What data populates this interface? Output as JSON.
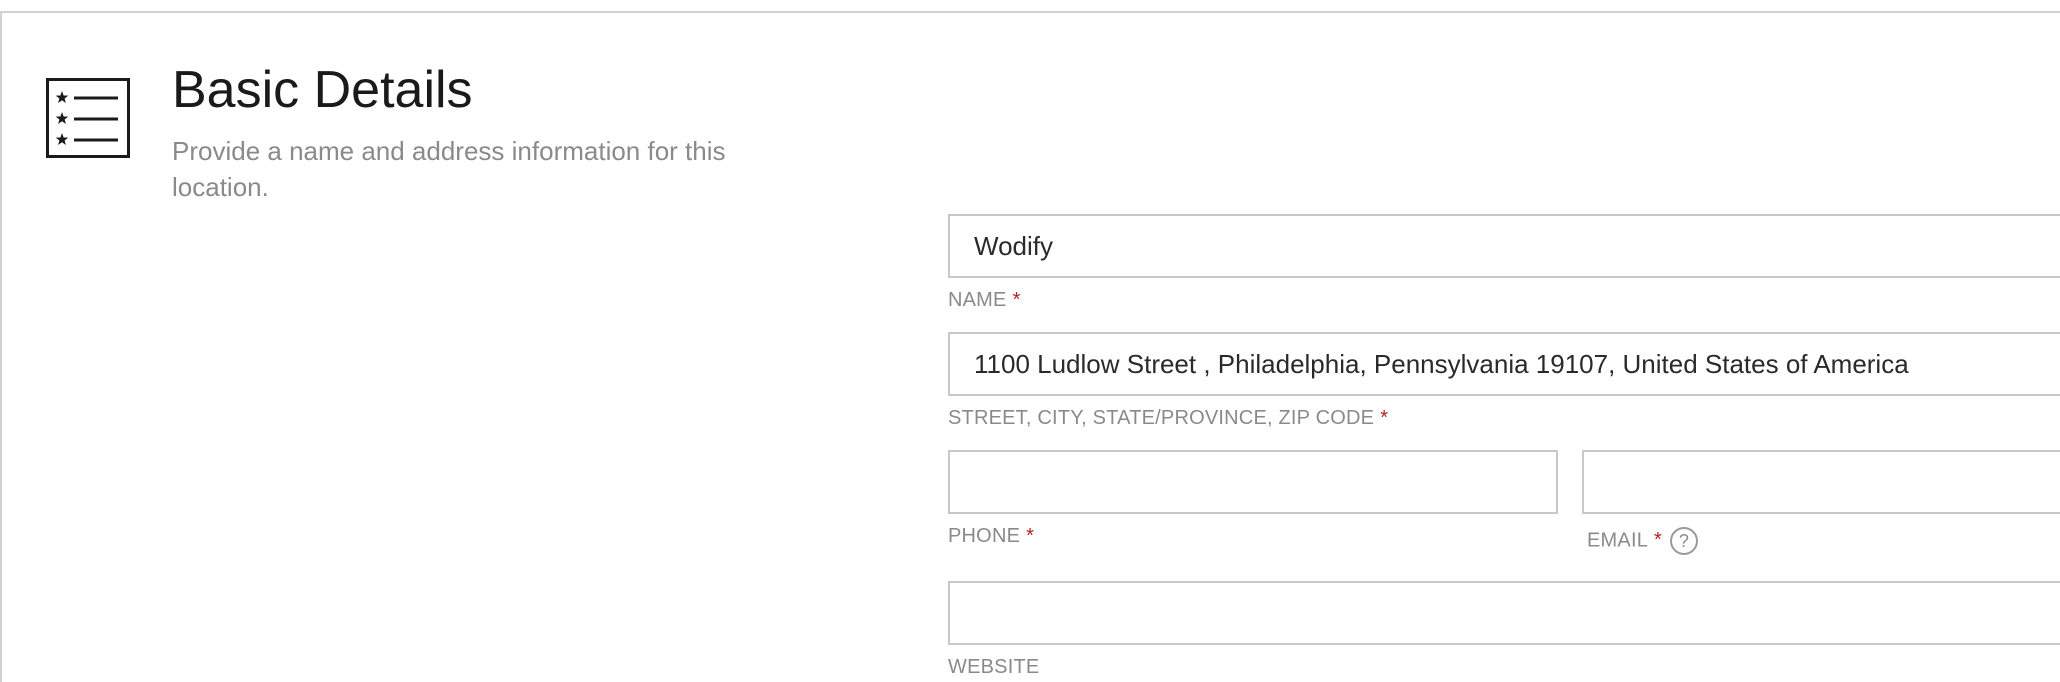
{
  "section": {
    "title": "Basic Details",
    "subtitle": "Provide a name and address information for this location."
  },
  "form": {
    "name": {
      "value": "Wodify",
      "label": "NAME",
      "required": "*"
    },
    "address": {
      "value": "1100 Ludlow Street , Philadelphia, Pennsylvania 19107, United States of America",
      "label": "STREET, CITY, STATE/PROVINCE, ZIP CODE",
      "required": "*"
    },
    "phone": {
      "value": "",
      "label": "PHONE",
      "required": "*"
    },
    "email": {
      "value": "",
      "label": "EMAIL",
      "required": "*",
      "help": "?"
    },
    "website": {
      "value": "",
      "label": "WEBSITE"
    }
  }
}
